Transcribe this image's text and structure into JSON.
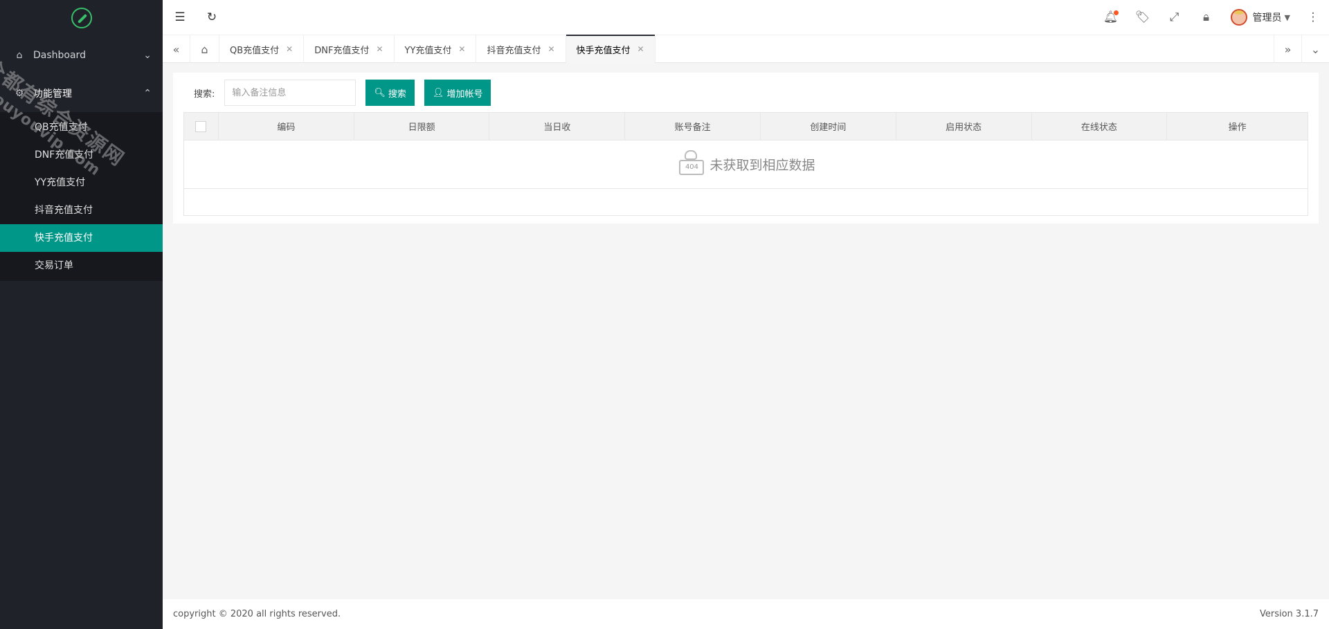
{
  "sidebar": {
    "groups": [
      {
        "label": "Dashboard",
        "icon": "home-icon"
      },
      {
        "label": "功能管理",
        "icon": "gear-icon"
      }
    ],
    "items": [
      {
        "label": "QB充值支付"
      },
      {
        "label": "DNF充值支付"
      },
      {
        "label": "YY充值支付"
      },
      {
        "label": "抖音充值支付"
      },
      {
        "label": "快手充值支付"
      },
      {
        "label": "交易订单"
      }
    ],
    "selected_index": 4
  },
  "watermark": {
    "line1": "全都有综合资源网",
    "line2": "douyouvip.com"
  },
  "header": {
    "user_name": "管理员",
    "notification_dot_color": "#ff5722"
  },
  "tabs": [
    {
      "label": "QB充值支付"
    },
    {
      "label": "DNF充值支付"
    },
    {
      "label": "YY充值支付"
    },
    {
      "label": "抖音充值支付"
    },
    {
      "label": "快手充值支付",
      "active": true
    }
  ],
  "search": {
    "label": "搜索:",
    "placeholder": "输入备注信息",
    "value": "",
    "search_button": "搜索",
    "add_button": "增加帐号"
  },
  "table": {
    "columns": [
      "编码",
      "日限额",
      "当日收",
      "账号备注",
      "创建时间",
      "启用状态",
      "在线状态",
      "操作"
    ],
    "rows": [],
    "empty_text": "未获取到相应数据"
  },
  "footer": {
    "copyright": "copyright © 2020 all rights reserved.",
    "version": "Version 3.1.7"
  },
  "colors": {
    "accent": "#009688",
    "sidebar_bg": "#20222a",
    "submenu_bg": "#16181d"
  }
}
